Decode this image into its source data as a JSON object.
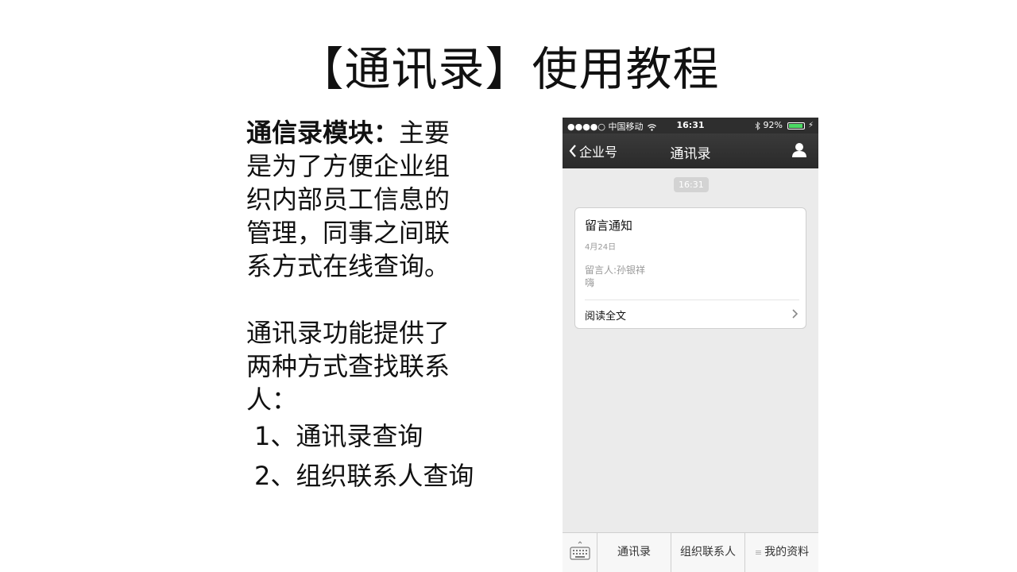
{
  "slide": {
    "title": "【通讯录】使用教程",
    "para1_bold": "通信录模块：",
    "para1_text": "主要是为了方便企业组织内部员工信息的管理，同事之间联系方式在线查询。",
    "para2_text": "通讯录功能提供了两种方式查找联系人：",
    "list": [
      {
        "num": "1、",
        "text": "通讯录查询"
      },
      {
        "num": "2、",
        "text": "组织联系人查询"
      }
    ]
  },
  "phone": {
    "status": {
      "carrier": "●●●●○ 中国移动",
      "time": "16:31",
      "battery": "92%",
      "battery_level": 0.92
    },
    "nav": {
      "back_label": "企业号",
      "title": "通讯录",
      "user_icon": "user-icon"
    },
    "chat_time": "16:31",
    "card": {
      "title": "留言通知",
      "date": "4月24日",
      "sender": "留言人:孙银祥",
      "message": "嗨",
      "read_more": "阅读全文"
    },
    "tabbar": {
      "keyboard_icon": "keyboard-icon",
      "tabs": [
        "通讯录",
        "组织联系人",
        "我的资料"
      ]
    },
    "colors": {
      "bar_dark": "#2e2e2e",
      "background": "#ebebeb",
      "battery_green": "#4cd964"
    }
  }
}
